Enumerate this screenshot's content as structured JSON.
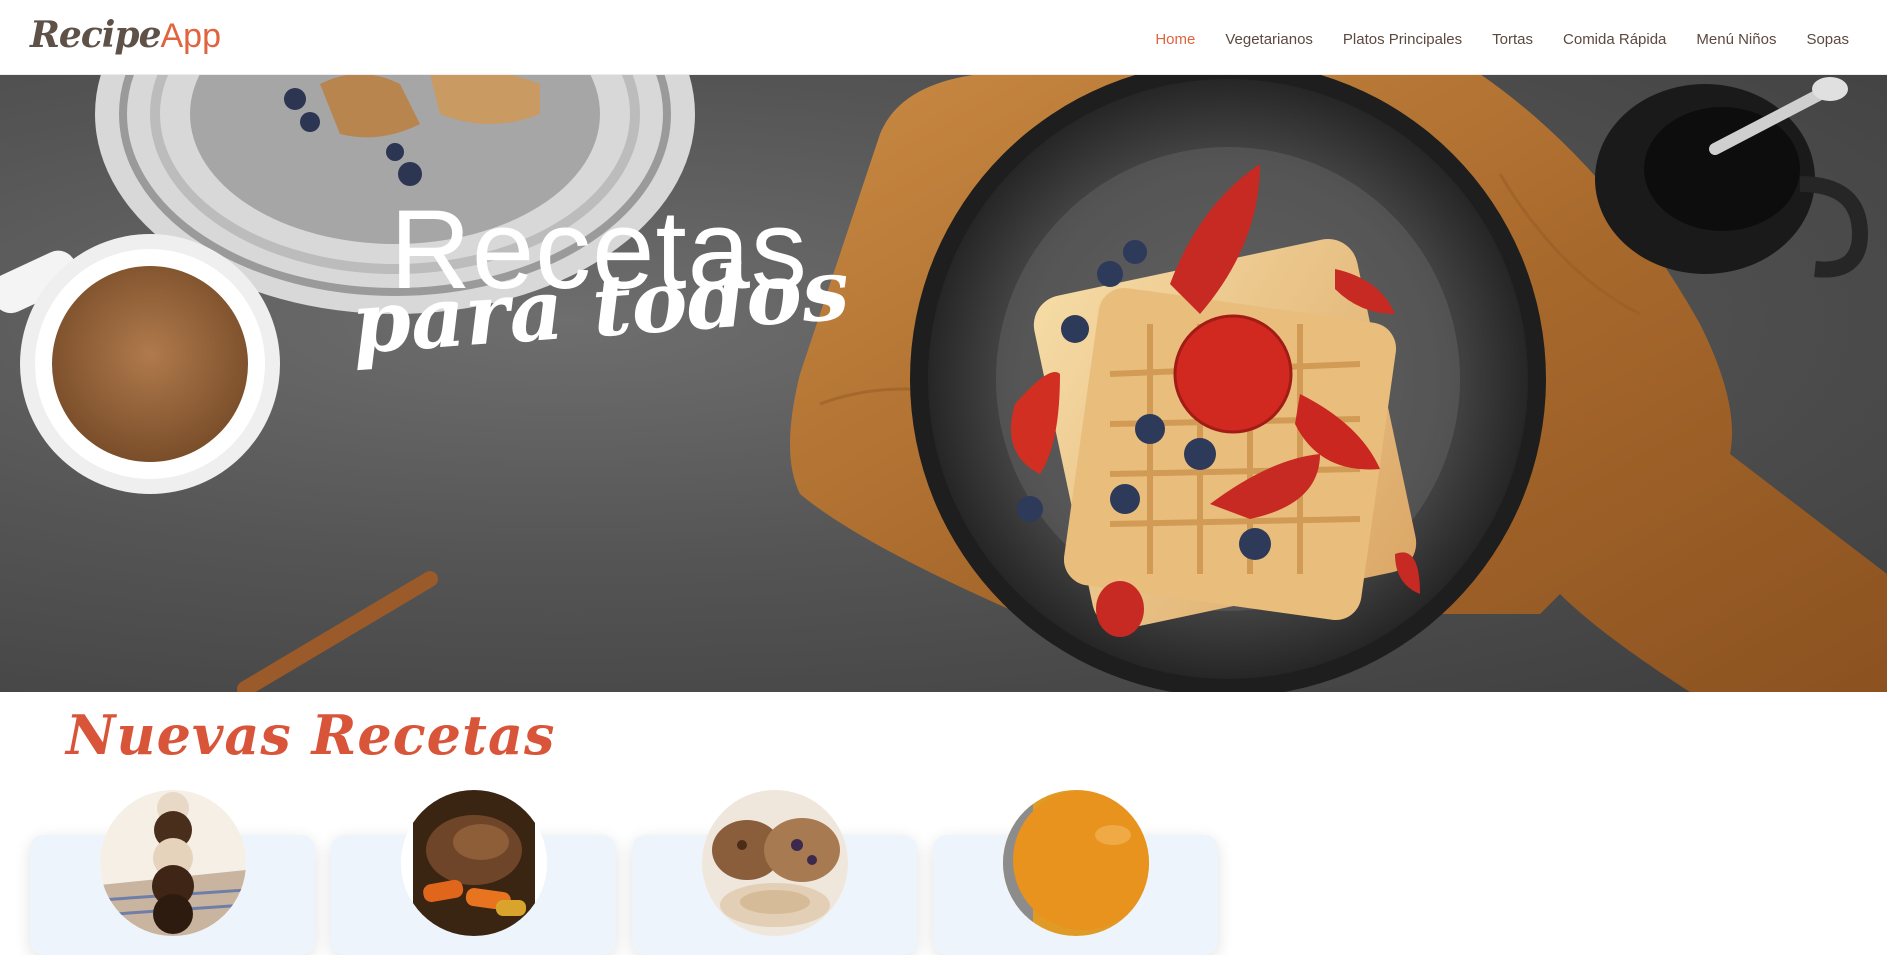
{
  "header": {
    "logo": {
      "part1": "Recipe",
      "part2": "App"
    },
    "nav": [
      {
        "label": "Home",
        "active": true
      },
      {
        "label": "Vegetarianos",
        "active": false
      },
      {
        "label": "Platos Principales",
        "active": false
      },
      {
        "label": "Tortas",
        "active": false
      },
      {
        "label": "Comida Rápida",
        "active": false
      },
      {
        "label": "Menú Niños",
        "active": false
      },
      {
        "label": "Sopas",
        "active": false
      }
    ]
  },
  "hero": {
    "title": "Recetas",
    "subtitle": "para todos"
  },
  "recipes": {
    "section_title": "Nuevas Recetas",
    "cards": [
      {
        "image": "stacked-cakepops-photo"
      },
      {
        "image": "braised-beef-with-carrots-photo"
      },
      {
        "image": "cookies-photo"
      },
      {
        "image": "orange-drink-photo"
      }
    ]
  },
  "colors": {
    "accent": "#e0643f",
    "section_title": "#d9553a",
    "nav_text": "#5b4a3f",
    "card_bg": "#eef4fb"
  }
}
